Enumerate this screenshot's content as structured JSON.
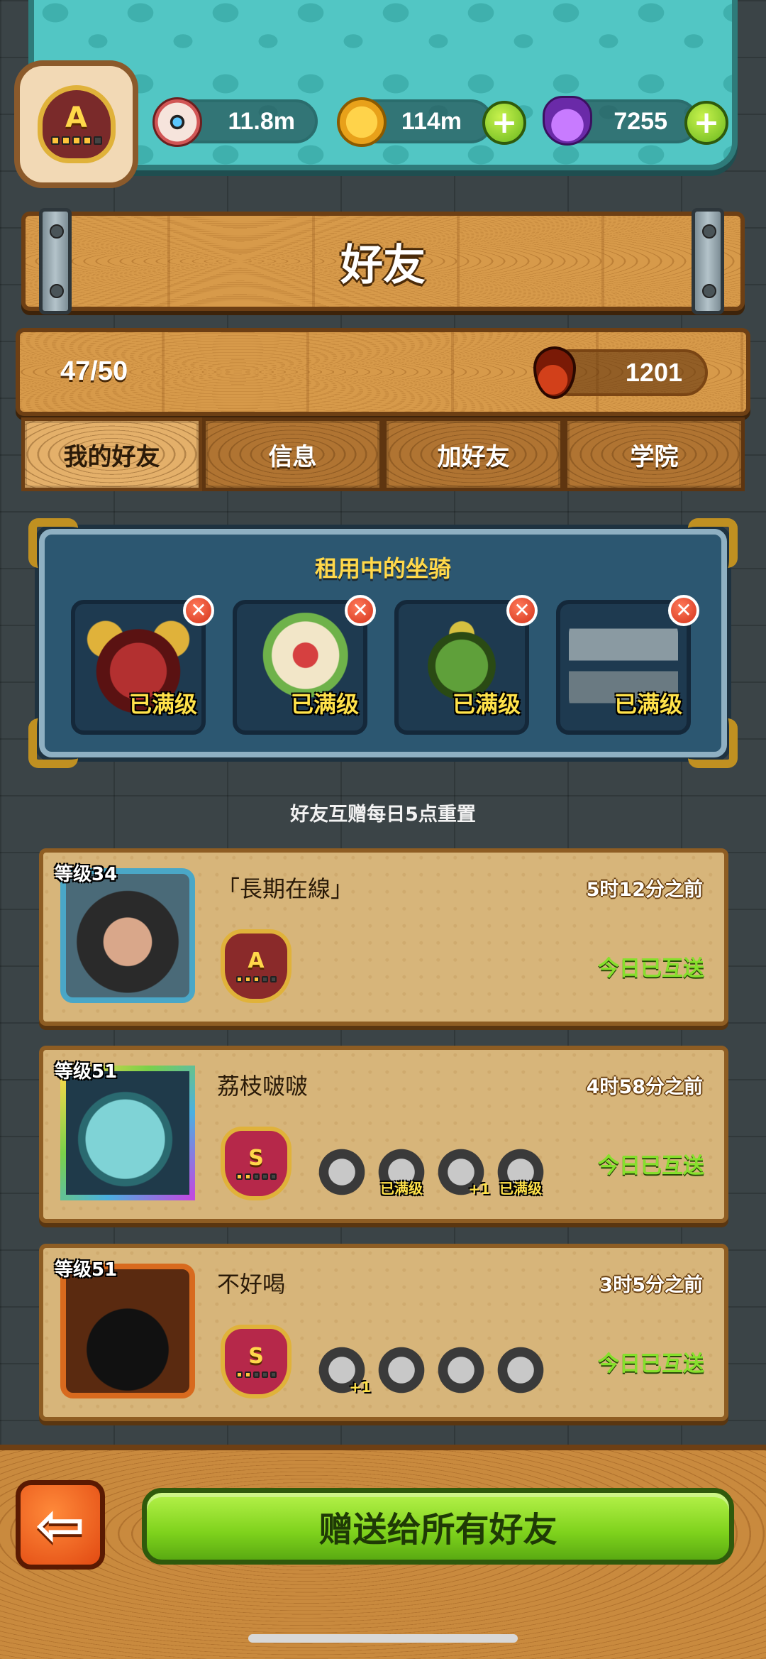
{
  "header": {
    "player_rank": "A",
    "resources": [
      {
        "icon": "eyeball-icon",
        "value": "11.8m"
      },
      {
        "icon": "gold-coin-icon",
        "value": "114m"
      },
      {
        "icon": "potion-icon",
        "value": "7255"
      }
    ]
  },
  "page": {
    "title": "好友",
    "friend_count": "47/50",
    "blood_currency": "1201"
  },
  "tabs": [
    {
      "label": "我的好友",
      "active": true
    },
    {
      "label": "信息",
      "active": false
    },
    {
      "label": "加好友",
      "active": false
    },
    {
      "label": "学院",
      "active": false
    }
  ],
  "rented_mounts": {
    "title": "租用中的坐骑",
    "slots": [
      {
        "status": "已满级"
      },
      {
        "status": "已满级"
      },
      {
        "status": "已满级"
      },
      {
        "status": "已满级"
      }
    ]
  },
  "reset_note": "好友互赠每日5点重置",
  "friends": [
    {
      "level": "等级34",
      "name": "「長期在線」",
      "last_seen": "5时12分之前",
      "gift_status": "今日已互送",
      "rank": "A",
      "mounts": []
    },
    {
      "level": "等级51",
      "name": "荔枝啵啵",
      "last_seen": "4时58分之前",
      "gift_status": "今日已互送",
      "rank": "S",
      "mounts": [
        {
          "label": ""
        },
        {
          "label": "已满级"
        },
        {
          "label": "+1"
        },
        {
          "label": "已满级"
        }
      ]
    },
    {
      "level": "等级51",
      "name": "不好喝",
      "last_seen": "3时5分之前",
      "gift_status": "今日已互送",
      "rank": "S",
      "mounts": [
        {
          "label": "+1"
        },
        {
          "label": ""
        },
        {
          "label": ""
        },
        {
          "label": ""
        }
      ]
    }
  ],
  "footer": {
    "back_icon": "back-arrow-icon",
    "back_glyph": "⇦",
    "gift_all_label": "赠送给所有好友"
  },
  "colors": {
    "accent_green": "#86e02c",
    "gold_text": "#ffd84a",
    "wood": "#d79a4a"
  }
}
